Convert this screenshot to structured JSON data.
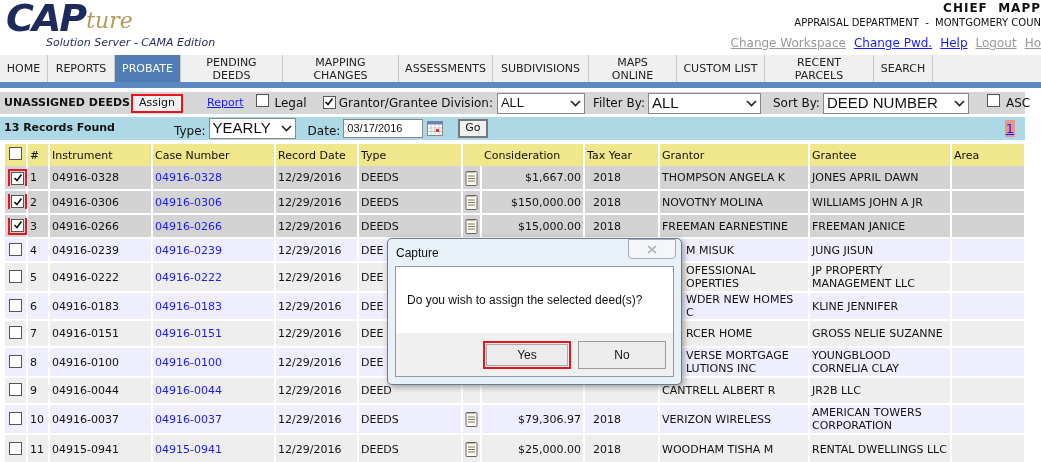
{
  "header": {
    "logo_main": "CAP",
    "logo_script": "ture",
    "tagline": "Solution Server - CAMA Edition",
    "user": "CHIEF  MAPP",
    "department": "APPRAISAL DEPARTMENT  -  MONTGOMERY COUN",
    "links": [
      {
        "label": "Change Workspace",
        "disabled": true
      },
      {
        "label": "Change Pwd.",
        "disabled": false
      },
      {
        "label": "Help",
        "disabled": false
      },
      {
        "label": "Logout",
        "disabled": true
      },
      {
        "label": "Ho",
        "disabled": true
      }
    ]
  },
  "tabs": [
    {
      "label": "HOME",
      "selected": false
    },
    {
      "label": "REPORTS",
      "selected": false
    },
    {
      "label": "PROBATE",
      "selected": true
    },
    {
      "label": "PENDING\nDEEDS",
      "selected": false
    },
    {
      "label": "MAPPING\nCHANGES",
      "selected": false
    },
    {
      "label": "ASSESSMENTS",
      "selected": false
    },
    {
      "label": "SUBDIVISIONS",
      "selected": false
    },
    {
      "label": "MAPS\nONLINE",
      "selected": false
    },
    {
      "label": "CUSTOM LIST",
      "selected": false
    },
    {
      "label": "RECENT\nPARCELS",
      "selected": false
    },
    {
      "label": "SEARCH",
      "selected": false
    }
  ],
  "toolbar": {
    "title": "UNASSIGNED DEEDS",
    "assign_button": {
      "label": "Assign",
      "highlighted": true
    },
    "report_link": "Report",
    "legal": {
      "label": "Legal",
      "checked": false
    },
    "grantor_division": {
      "label": "Grantor/Grantee Division:",
      "checked": true,
      "value": "ALL"
    },
    "filter": {
      "label": "Filter By:",
      "value": "ALL"
    },
    "sort": {
      "label": "Sort By:",
      "value": "DEED NUMBER"
    },
    "asc": {
      "label": "ASC",
      "checked": false
    }
  },
  "records_bar": {
    "count": "13 Records Found",
    "type_label": "Type:",
    "type_value": "YEARLY",
    "date_label": "Date:",
    "date_value": "03/17/2016",
    "go": "Go",
    "page": "1"
  },
  "table": {
    "select_all_checked": false,
    "columns": [
      "#",
      "Instrument",
      "Case Number",
      "Record Date",
      "Type",
      "Consideration",
      "Tax Year",
      "Grantor",
      "Grantee",
      "Area"
    ],
    "rows": [
      {
        "checked": true,
        "highlighted": true,
        "covered": false,
        "num": "1",
        "instrument": "04916-0328",
        "case": "04916-0328",
        "date": "12/29/2016",
        "type": "DEEDS",
        "consideration": "$1,667.00",
        "tax_year": "2018",
        "grantor": "THOMPSON ANGELA K",
        "grantee": "JONES APRIL DAWN"
      },
      {
        "checked": true,
        "highlighted": true,
        "covered": false,
        "num": "2",
        "instrument": "04916-0306",
        "case": "04916-0306",
        "date": "12/29/2016",
        "type": "DEEDS",
        "consideration": "$150,000.00",
        "tax_year": "2018",
        "grantor": "NOVOTNY MOLINA",
        "grantee": "WILLIAMS JOHN A JR"
      },
      {
        "checked": true,
        "highlighted": true,
        "covered": false,
        "num": "3",
        "instrument": "04916-0266",
        "case": "04916-0266",
        "date": "12/29/2016",
        "type": "DEEDS",
        "consideration": "$15,000.00",
        "tax_year": "2018",
        "grantor": "FREEMAN EARNESTINE",
        "grantee": "FREEMAN JANICE"
      },
      {
        "checked": false,
        "highlighted": false,
        "covered": true,
        "num": "4",
        "instrument": "04916-0239",
        "case": "04916-0239",
        "date": "12/29/2016",
        "type": "DEE",
        "grantor": "M MISUK",
        "grantee": "JUNG JISUN"
      },
      {
        "checked": false,
        "highlighted": false,
        "covered": true,
        "num": "5",
        "instrument": "04916-0222",
        "case": "04916-0222",
        "date": "12/29/2016",
        "type": "DEE",
        "grantor": "OFESSIONAL\nOPERTIES",
        "grantee": "JP PROPERTY MANAGEMENT LLC"
      },
      {
        "checked": false,
        "highlighted": false,
        "covered": true,
        "num": "6",
        "instrument": "04916-0183",
        "case": "04916-0183",
        "date": "12/29/2016",
        "type": "DEE",
        "grantor": "WDER NEW HOMES\nC",
        "grantee": "KLINE JENNIFER"
      },
      {
        "checked": false,
        "highlighted": false,
        "covered": true,
        "num": "7",
        "instrument": "04916-0151",
        "case": "04916-0151",
        "date": "12/29/2016",
        "type": "DEE",
        "grantor": "RCER HOME",
        "grantee": "GROSS NELIE SUZANNE"
      },
      {
        "checked": false,
        "highlighted": false,
        "covered": true,
        "num": "8",
        "instrument": "04916-0100",
        "case": "04916-0100",
        "date": "12/29/2016",
        "type": "DEE",
        "grantor": "VERSE MORTGAGE\nLUTIONS INC",
        "grantee": "YOUNGBLOOD CORNELIA CLAY"
      },
      {
        "checked": false,
        "highlighted": false,
        "covered": false,
        "num": "9",
        "instrument": "04916-0044",
        "case": "04916-0044",
        "date": "12/29/2016",
        "type": "DEED",
        "grantor": "CANTRELL ALBERT R",
        "grantee": "JR2B LLC"
      },
      {
        "checked": false,
        "highlighted": false,
        "covered": false,
        "num": "10",
        "instrument": "04916-0037",
        "case": "04916-0037",
        "date": "12/29/2016",
        "type": "DEEDS",
        "consideration": "$79,306.97",
        "tax_year": "2018",
        "grantor": "VERIZON WIRELESS",
        "grantee": "AMERICAN TOWERS CORPORATION"
      },
      {
        "checked": false,
        "highlighted": false,
        "covered": false,
        "num": "11",
        "instrument": "04915-0941",
        "case": "04915-0941",
        "date": "12/29/2016",
        "type": "DEEDS",
        "consideration": "$25,000.00",
        "tax_year": "2018",
        "grantor": "WOODHAM TISHA M",
        "grantee": "RENTAL DWELLINGS LLC"
      }
    ]
  },
  "dialog": {
    "title": "Capture",
    "message": "Do you wish to assign the selected deed(s)?",
    "buttons": [
      {
        "label": "Yes",
        "highlighted": true
      },
      {
        "label": "No",
        "highlighted": false
      }
    ]
  }
}
